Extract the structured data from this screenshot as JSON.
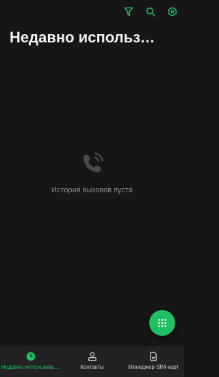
{
  "colors": {
    "background": "#161616",
    "accent": "#1fbf63",
    "nav_background": "#222222",
    "muted_text": "#8c8c8c"
  },
  "toolbar": {
    "icons": [
      "filter-icon",
      "search-icon",
      "settings-icon"
    ]
  },
  "page": {
    "title": "Недавно использованные"
  },
  "empty_state": {
    "icon": "phone-call-icon",
    "text": "История вызовов пуста"
  },
  "fab": {
    "icon": "dialpad-icon"
  },
  "bottom_nav": {
    "items": [
      {
        "label": "Недавно использованные",
        "icon": "clock-icon",
        "active": true
      },
      {
        "label": "Контакты",
        "icon": "contact-icon",
        "active": false
      },
      {
        "label": "Менеджер SIM-карт",
        "icon": "sim-card-icon",
        "active": false
      }
    ]
  }
}
